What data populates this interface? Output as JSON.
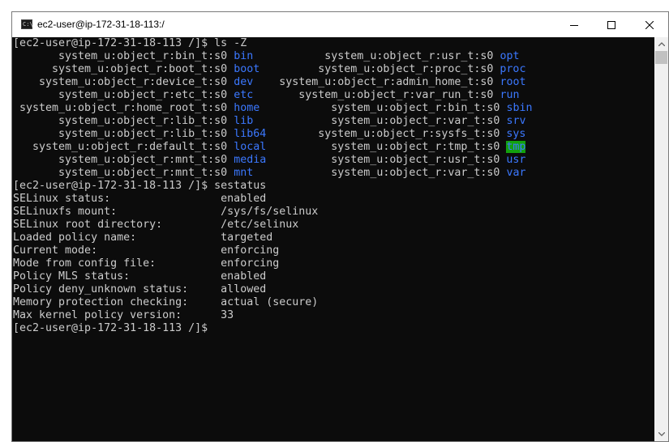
{
  "window": {
    "title": "ec2-user@ip-172-31-18-113:/",
    "icon_label": "C:\\",
    "icon": "console-icon"
  },
  "colors": {
    "background": "#0c0c0c",
    "text": "#cccccc",
    "directory": "#3b78ff",
    "highlight_bg": "#13a10e"
  },
  "terminal": {
    "lines": [
      [
        {
          "t": "[ec2-user@ip-172-31-18-113 /]$ ls -Z"
        }
      ],
      [
        {
          "t": "       system_u:object_r:bin_t:s0 "
        },
        {
          "t": "bin",
          "c": "dir"
        },
        {
          "t": "           system_u:object_r:usr_t:s0 "
        },
        {
          "t": "opt",
          "c": "dir"
        }
      ],
      [
        {
          "t": "      system_u:object_r:boot_t:s0 "
        },
        {
          "t": "boot",
          "c": "dir"
        },
        {
          "t": "         system_u:object_r:proc_t:s0 "
        },
        {
          "t": "proc",
          "c": "dir"
        }
      ],
      [
        {
          "t": "    system_u:object_r:device_t:s0 "
        },
        {
          "t": "dev",
          "c": "dir"
        },
        {
          "t": "    system_u:object_r:admin_home_t:s0 "
        },
        {
          "t": "root",
          "c": "dir"
        }
      ],
      [
        {
          "t": "       system_u:object_r:etc_t:s0 "
        },
        {
          "t": "etc",
          "c": "dir"
        },
        {
          "t": "       system_u:object_r:var_run_t:s0 "
        },
        {
          "t": "run",
          "c": "dir"
        }
      ],
      [
        {
          "t": " system_u:object_r:home_root_t:s0 "
        },
        {
          "t": "home",
          "c": "dir"
        },
        {
          "t": "           system_u:object_r:bin_t:s0 "
        },
        {
          "t": "sbin",
          "c": "dir"
        }
      ],
      [
        {
          "t": "       system_u:object_r:lib_t:s0 "
        },
        {
          "t": "lib",
          "c": "dir"
        },
        {
          "t": "            system_u:object_r:var_t:s0 "
        },
        {
          "t": "srv",
          "c": "dir"
        }
      ],
      [
        {
          "t": "       system_u:object_r:lib_t:s0 "
        },
        {
          "t": "lib64",
          "c": "dir"
        },
        {
          "t": "        system_u:object_r:sysfs_t:s0 "
        },
        {
          "t": "sys",
          "c": "dir"
        }
      ],
      [
        {
          "t": "   system_u:object_r:default_t:s0 "
        },
        {
          "t": "local",
          "c": "dir"
        },
        {
          "t": "          system_u:object_r:tmp_t:s0 "
        },
        {
          "t": "tmp",
          "c": "tmp"
        }
      ],
      [
        {
          "t": "       system_u:object_r:mnt_t:s0 "
        },
        {
          "t": "media",
          "c": "dir"
        },
        {
          "t": "          system_u:object_r:usr_t:s0 "
        },
        {
          "t": "usr",
          "c": "dir"
        }
      ],
      [
        {
          "t": "       system_u:object_r:mnt_t:s0 "
        },
        {
          "t": "mnt",
          "c": "dir"
        },
        {
          "t": "            system_u:object_r:var_t:s0 "
        },
        {
          "t": "var",
          "c": "dir"
        }
      ],
      [
        {
          "t": "[ec2-user@ip-172-31-18-113 /]$ sestatus"
        }
      ],
      [
        {
          "t": "SELinux status:                 enabled"
        }
      ],
      [
        {
          "t": "SELinuxfs mount:                /sys/fs/selinux"
        }
      ],
      [
        {
          "t": "SELinux root directory:         /etc/selinux"
        }
      ],
      [
        {
          "t": "Loaded policy name:             targeted"
        }
      ],
      [
        {
          "t": "Current mode:                   enforcing"
        }
      ],
      [
        {
          "t": "Mode from config file:          enforcing"
        }
      ],
      [
        {
          "t": "Policy MLS status:              enabled"
        }
      ],
      [
        {
          "t": "Policy deny_unknown status:     allowed"
        }
      ],
      [
        {
          "t": "Memory protection checking:     actual (secure)"
        }
      ],
      [
        {
          "t": "Max kernel policy version:      33"
        }
      ],
      [
        {
          "t": "[ec2-user@ip-172-31-18-113 /]$"
        }
      ]
    ]
  }
}
